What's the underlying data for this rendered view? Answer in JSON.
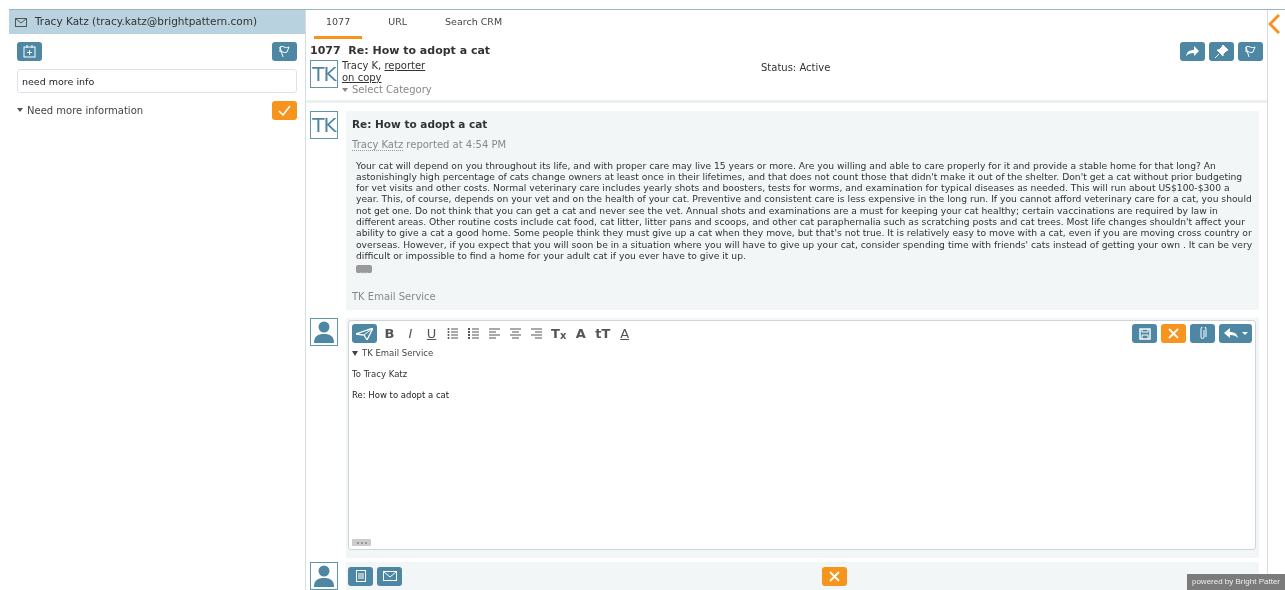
{
  "sidebar": {
    "header": "Tracy Katz (tracy.katz@brightpattern.com)",
    "note": {
      "value": "need more info"
    },
    "disposition": {
      "label": "Need more information",
      "expanded": true
    }
  },
  "tabs": [
    {
      "label": "1077",
      "selected": true
    },
    {
      "label": "URL",
      "selected": false
    },
    {
      "label": "Search CRM",
      "selected": false
    }
  ],
  "case": {
    "number": "1077",
    "subject": "Re: How to adopt a cat",
    "avatar": "TK",
    "author": "Tracy K,",
    "role_link": "reporter",
    "copy_link": "on copy",
    "category": "Select Category",
    "status": "Status: Active"
  },
  "message": {
    "avatar": "TK",
    "subject": "Re: How to adopt a cat",
    "author": "Tracy Katz",
    "reported": "reported at 4:54 PM",
    "body": "Your cat will depend on you throughout its life, and with proper care may live 15 years or more. Are you willing and able to care properly for it and provide a stable home for that long? An astonishingly high percentage of cats change owners at least once in their lifetimes, and that does not count those that didn't make it out of the shelter. Don't get a cat without prior budgeting for vet visits and other costs. Normal veterinary care includes yearly shots and boosters, tests for worms, and examination for typical diseases as needed. This will run about US$100-$300 a year. This, of course, depends on your vet and on the health of your cat. Preventive and consistent care is less expensive in the long run. If you cannot afford veterinary care for a cat, you should not get one. Do not think that you can get a cat and never see the vet. Annual shots and examinations are a must for keeping your cat healthy; certain vaccinations are required by law in different areas. Other routine costs include cat food, cat litter, litter pans and scoops, and other cat paraphernalia such as scratching posts and cat trees. Most life changes shouldn't affect your ability to give a cat a good home. Some people think they must give up a cat when they move, but that's not true. It is relatively easy to move with a cat, even if you are moving cross country or overseas. However, if you expect that you will soon be in a situation where you will have to give up your cat, consider spending time with friends' cats instead of getting your own . It can be very difficult or impossible to find a home for your adult cat if you ever have to give it up.",
    "signature": "TK Email Service"
  },
  "editor": {
    "toolbar": [
      {
        "kind": "send",
        "active": true
      },
      {
        "kind": "text",
        "label": "B"
      },
      {
        "kind": "text",
        "label": "I"
      },
      {
        "kind": "text",
        "label": "U"
      },
      {
        "kind": "bullets"
      },
      {
        "kind": "numbers"
      },
      {
        "kind": "align-left"
      },
      {
        "kind": "align-center"
      },
      {
        "kind": "align-right"
      },
      {
        "kind": "text",
        "label": "T$_{x}$"
      },
      {
        "kind": "text",
        "label": "A"
      },
      {
        "kind": "text",
        "label": "tT"
      },
      {
        "kind": "text",
        "label": "A"
      }
    ],
    "from": "TK Email Service",
    "to": "To Tracy Katz",
    "subject": "Re: How to adopt a cat"
  },
  "footer": "powered by Bright Patter"
}
